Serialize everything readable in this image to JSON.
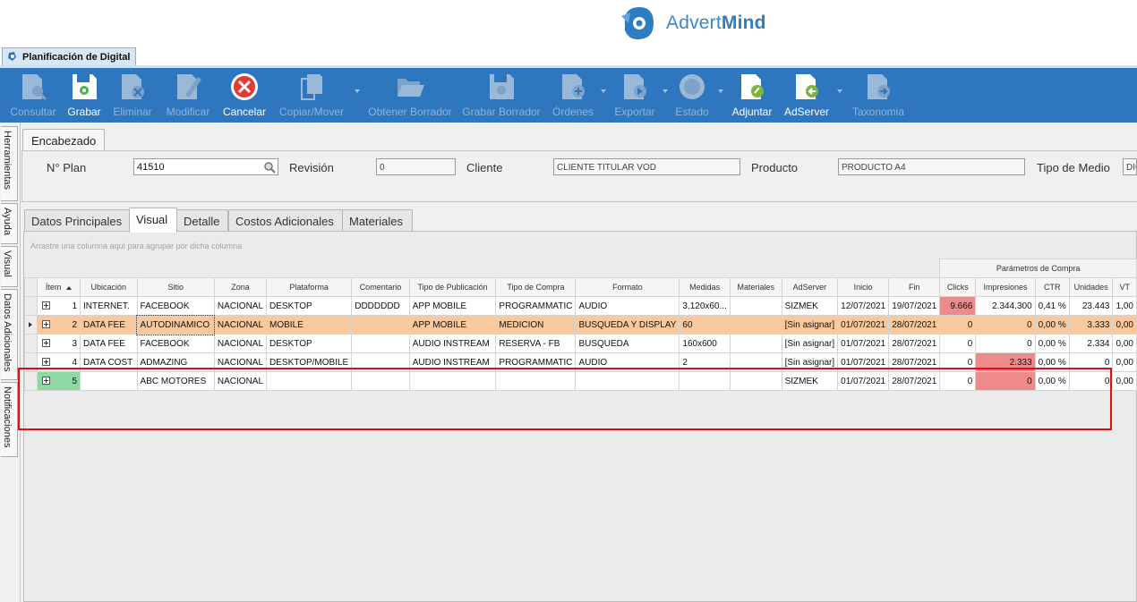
{
  "brand": {
    "part1": "Advert",
    "part2": "Mind"
  },
  "document_tab": {
    "label": "Planificación de Digital"
  },
  "toolbar": {
    "items": [
      {
        "label": "Consultar",
        "icon": "search-doc-icon"
      },
      {
        "label": "Grabar",
        "icon": "save-icon"
      },
      {
        "label": "Eliminar",
        "icon": "delete-doc-icon"
      },
      {
        "label": "Modificar",
        "icon": "edit-doc-icon"
      },
      {
        "label": "Cancelar",
        "icon": "cancel-icon"
      },
      {
        "label": "Copiar/Mover",
        "icon": "copy-icon"
      },
      {
        "label": "Obtener Borrador",
        "icon": "folder-open-icon"
      },
      {
        "label": "Grabar Borrador",
        "icon": "save-draft-icon"
      },
      {
        "label": "Órdenes",
        "icon": "orders-icon"
      },
      {
        "label": "Exportar",
        "icon": "export-icon"
      },
      {
        "label": "Estado",
        "icon": "status-icon"
      },
      {
        "label": "Adjuntar",
        "icon": "attach-icon"
      },
      {
        "label": "AdServer",
        "icon": "adserver-icon"
      },
      {
        "label": "Taxonomia",
        "icon": "taxonomy-icon"
      }
    ]
  },
  "sidebar": {
    "tabs": [
      "Herramientas",
      "Ayuda",
      "Visual",
      "Datos Adicionales",
      "Notificaciones"
    ]
  },
  "header_group": {
    "title": "Encabezado",
    "plan_label": "N° Plan",
    "plan_value": "41510",
    "revision_label": "Revisión",
    "revision_value": "0",
    "client_label": "Cliente",
    "client_value": "CLIENTE TITULAR VOD",
    "product_label": "Producto",
    "product_value": "PRODUCTO A4",
    "media_type_label": "Tipo de Medio",
    "media_type_value": "DIG"
  },
  "view_tabs": [
    "Datos Principales",
    "Visual",
    "Detalle",
    "Costos Adicionales",
    "Materiales"
  ],
  "grid": {
    "group_hint": "Arrastre una columna aquí para agrupar por dicha columna",
    "band_title": "Parámetros de Compra",
    "columns": [
      "Ítem",
      "Ubicación",
      "Sitio",
      "Zona",
      "Plataforma",
      "Comentario",
      "Tipo de Publicación",
      "Tipo de Compra",
      "Formato",
      "Medidas",
      "Materiales",
      "AdServer",
      "Inicio",
      "Fin",
      "Clicks",
      "Impresiones",
      "CTR",
      "Unidades",
      "VT"
    ],
    "rows": [
      [
        "1",
        "INTERNET.",
        "FACEBOOK",
        "NACIONAL",
        "DESKTOP",
        "DDDDDDD",
        "APP MOBILE",
        "PROGRAMMATIC",
        "AUDIO",
        "3.120x60...",
        "",
        "SIZMEK",
        "12/07/2021",
        "19/07/2021",
        "9.666",
        "2.344.300",
        "0,41 %",
        "23.443",
        "1,00"
      ],
      [
        "2",
        "DATA FEE",
        "AUTODINAMICO",
        "NACIONAL",
        "MOBILE",
        "",
        "APP MOBILE",
        "MEDICION",
        "BUSQUEDA Y DISPLAY",
        "60",
        "",
        "[Sin asignar]",
        "01/07/2021",
        "28/07/2021",
        "0",
        "0",
        "0,00 %",
        "3.333",
        "0,00"
      ],
      [
        "3",
        "DATA FEE",
        "FACEBOOK",
        "NACIONAL",
        "DESKTOP",
        "",
        "AUDIO INSTREAM",
        "RESERVA - FB",
        "BUSQUEDA",
        "160x600",
        "",
        "[Sin asignar]",
        "01/07/2021",
        "28/07/2021",
        "0",
        "0",
        "0,00 %",
        "2.334",
        "0,00"
      ],
      [
        "4",
        "DATA COST",
        "ADMAZING",
        "NACIONAL",
        "DESKTOP/MOBILE",
        "",
        "AUDIO INSTREAM",
        "PROGRAMMATIC",
        "AUDIO",
        "2",
        "",
        "[Sin asignar]",
        "01/07/2021",
        "28/07/2021",
        "0",
        "2.333",
        "0,00 %",
        "0",
        "0,00"
      ],
      [
        "5",
        "",
        "ABC MOTORES",
        "NACIONAL",
        "",
        "",
        "",
        "",
        "",
        "",
        "",
        "SIZMEK",
        "01/07/2021",
        "28/07/2021",
        "0",
        "0",
        "0,00 %",
        "0",
        "0,00"
      ]
    ]
  },
  "colors": {
    "toolbar": "#2e77bf",
    "selected_row": "#f9c89c",
    "alert_cell": "#ef8a8a",
    "new_row": "#8ed8a4",
    "highlight": "#e01010"
  }
}
